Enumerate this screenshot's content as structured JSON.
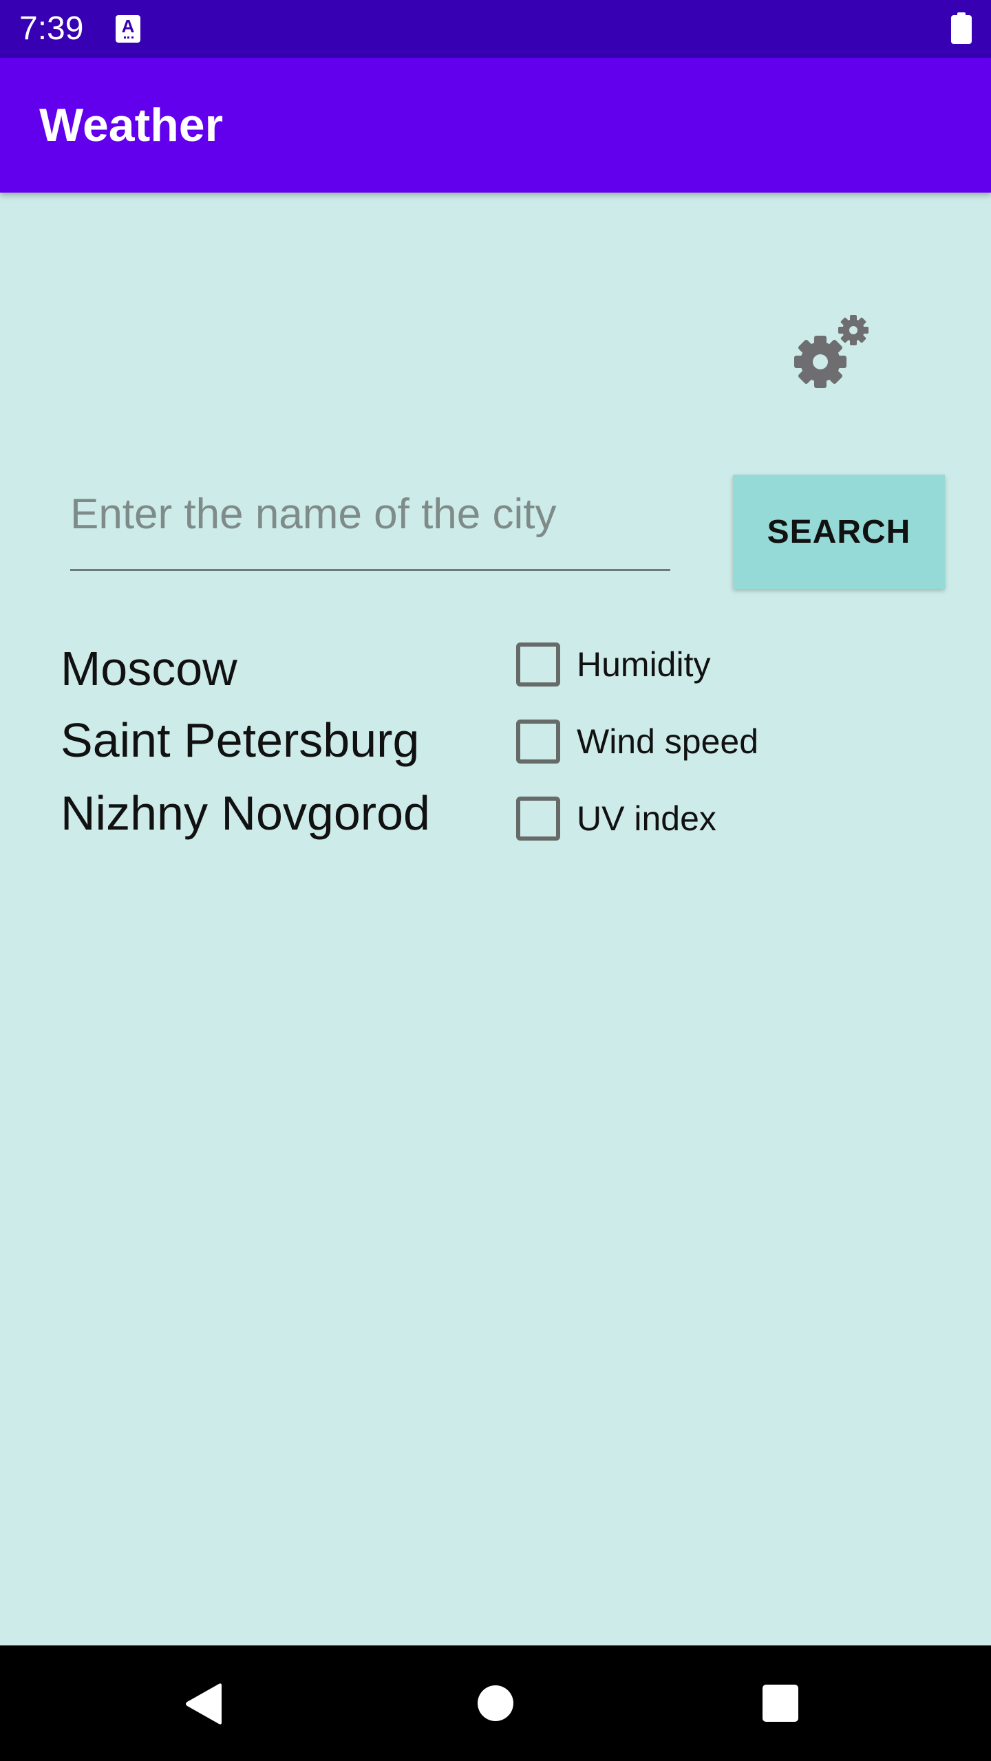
{
  "status_bar": {
    "time": "7:39",
    "notification_icon_letter": "A",
    "battery_icon": "battery-full-icon"
  },
  "app_bar": {
    "title": "Weather",
    "color": "#6200ee"
  },
  "settings": {
    "icon": "gear-icon"
  },
  "search": {
    "placeholder": "Enter the name of the city",
    "value": "",
    "button_label": "SEARCH"
  },
  "cities": [
    "Moscow",
    "Saint Petersburg",
    "Nizhny Novgorod"
  ],
  "options": [
    {
      "label": "Humidity",
      "checked": false
    },
    {
      "label": "Wind speed",
      "checked": false
    },
    {
      "label": "UV index",
      "checked": false
    }
  ],
  "nav_bar": {
    "back_icon": "back-triangle-icon",
    "home_icon": "home-circle-icon",
    "recents_icon": "recents-square-icon"
  },
  "colors": {
    "background": "#cdebe8",
    "status_bar": "#3700b3",
    "search_button": "#95dad6"
  }
}
